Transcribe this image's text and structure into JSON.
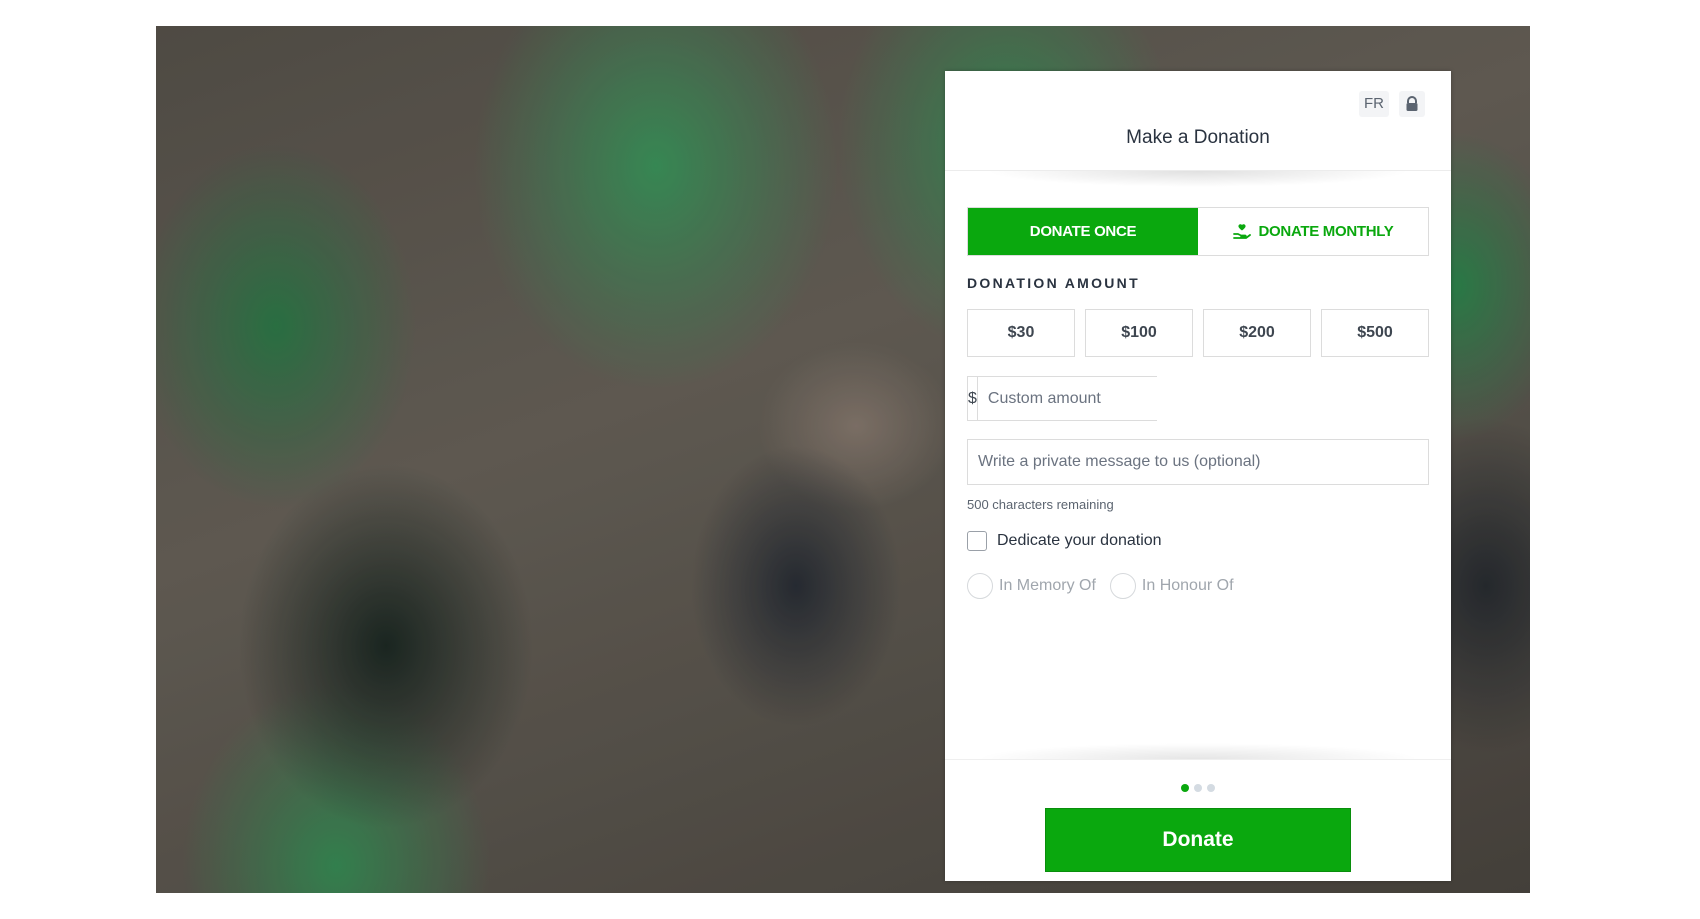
{
  "form": {
    "title": "Make a Donation",
    "language_toggle": "FR",
    "tabs": [
      {
        "label": "DONATE ONCE",
        "active": true
      },
      {
        "label": "DONATE MONTHLY",
        "active": false,
        "icon": "hand-heart-icon"
      }
    ],
    "amount_label": "DONATION AMOUNT",
    "amounts": [
      "$30",
      "$100",
      "$200",
      "$500"
    ],
    "custom_amount": {
      "currency": "$",
      "placeholder": "Custom amount",
      "value": ""
    },
    "message": {
      "placeholder": "Write a private message to us (optional)",
      "value": ""
    },
    "chars_remaining": "500 characters remaining",
    "dedicate_label": "Dedicate your donation",
    "dedicate_checked": false,
    "dedication_options": [
      "In Memory Of",
      "In Honour Of"
    ],
    "steps": {
      "total": 3,
      "current": 1
    },
    "donate_button": "Donate"
  },
  "colors": {
    "accent": "#0aa80e",
    "text": "#2a3340",
    "muted": "#a0a6ad"
  },
  "background": {
    "description_icon": "volunteers-photo"
  }
}
